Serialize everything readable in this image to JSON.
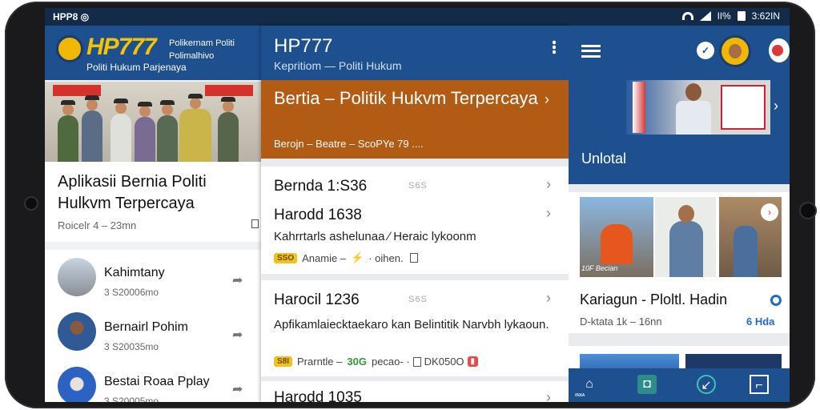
{
  "status_bar": {
    "left": "HPP8 ◎",
    "time": "3:62IN",
    "mid": "ǀǀ%"
  },
  "left_panel": {
    "brand": "HP777",
    "tag1": "Polikernam Politi",
    "tag2": "Polimalhivo",
    "subtitle": "Politi Hukum Parjenaya",
    "article_title": "Aplikasii Bernia Politi Hulkvm Terpercaya",
    "article_meta": "Roicelr 4 – 23mn",
    "list": [
      {
        "name": "Kahimtany",
        "sub": "3 S20006mo"
      },
      {
        "name": "Bernairl Pohim",
        "sub": "3 S20035mo"
      },
      {
        "name": "Bestai Roaa Pplay",
        "sub": "3 S20005mo"
      }
    ]
  },
  "middle_panel": {
    "title": "HP777",
    "subtitle": "Kepritiom — Politi Hukum",
    "hero_title": "Bertia – Politik Hukvm Terpercaya",
    "hero_meta": "Berojn – Beatre – ScoPYe 79   ....",
    "items": [
      {
        "title": "Bernda 1:S36",
        "code": "S6S"
      },
      {
        "title": "Harodd 1638",
        "desc": "Kahrrtarls ashelunaa ∕ Heraic lykoonm",
        "tag": "SSO",
        "meta": "Anamie  –",
        "meta2": "· oihen."
      },
      {
        "title": "Harocil 1236",
        "code": "S6S",
        "desc": "Apfikamlaiecktaekaro kan Belintitik Narvbh lykaoun.",
        "tag": "S8I",
        "meta": "Prarntle –",
        "num": "30G",
        "meta2": "pecao- ·",
        "red": "DK050O"
      },
      {
        "title": "Harodd 1035"
      }
    ]
  },
  "right_panel": {
    "chat_label": "✓",
    "section": "Unlotal",
    "card_title": "Kariagun - Ploltl. Hadin",
    "card_meta": "D-ktata 1k – 16nn",
    "card_link": "6 Hda",
    "thumb_caption": "10F Becian",
    "nav_label": "ʍᴚᴀ",
    "nav": [
      "home-icon",
      "shop-icon",
      "chat-icon",
      "window-icon"
    ]
  }
}
